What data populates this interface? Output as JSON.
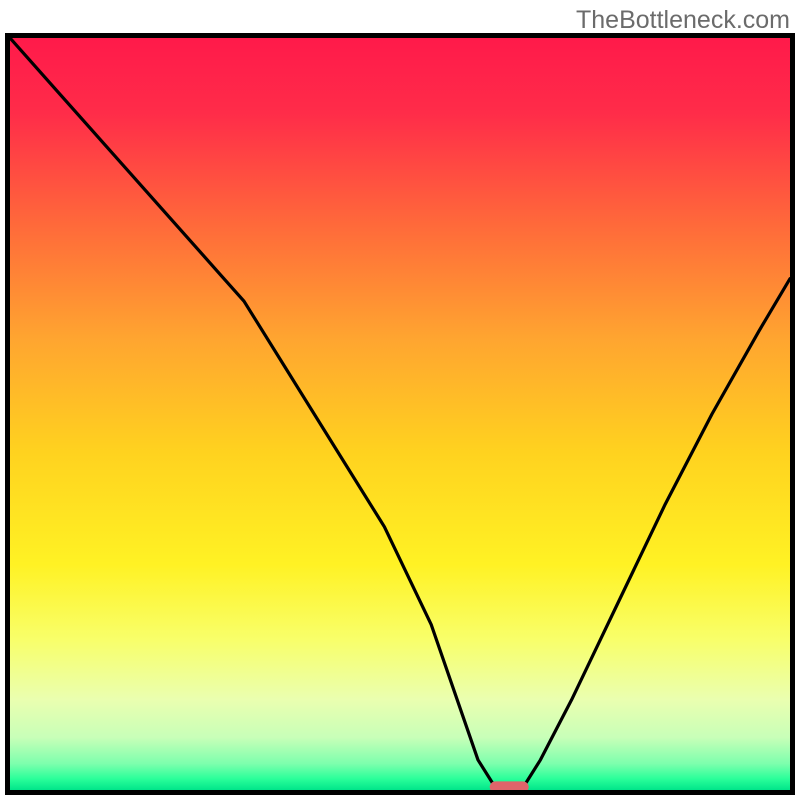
{
  "watermark": "TheBottleneck.com",
  "chart_data": {
    "type": "line",
    "title": "",
    "xlabel": "",
    "ylabel": "",
    "xlim": [
      0,
      100
    ],
    "ylim": [
      0,
      100
    ],
    "grid": false,
    "legend": false,
    "background_gradient": {
      "stops": [
        {
          "pos": 0.0,
          "color": "#ff1a4a"
        },
        {
          "pos": 0.1,
          "color": "#ff2c49"
        },
        {
          "pos": 0.25,
          "color": "#ff6a3a"
        },
        {
          "pos": 0.4,
          "color": "#ffa530"
        },
        {
          "pos": 0.55,
          "color": "#ffd21f"
        },
        {
          "pos": 0.7,
          "color": "#fff224"
        },
        {
          "pos": 0.8,
          "color": "#f8ff6a"
        },
        {
          "pos": 0.88,
          "color": "#eaffb0"
        },
        {
          "pos": 0.93,
          "color": "#c8ffb8"
        },
        {
          "pos": 0.965,
          "color": "#7dffad"
        },
        {
          "pos": 0.985,
          "color": "#2bff9a"
        },
        {
          "pos": 1.0,
          "color": "#00e58a"
        }
      ]
    },
    "series": [
      {
        "name": "bottleneck-curve",
        "color": "#000000",
        "x": [
          0,
          6,
          12,
          18,
          24,
          27,
          30,
          36,
          42,
          48,
          54,
          58,
          60,
          62,
          64,
          66,
          68,
          72,
          78,
          84,
          90,
          96,
          100
        ],
        "y": [
          100,
          93,
          86,
          79,
          72,
          68.5,
          65,
          55,
          45,
          35,
          22,
          10,
          4,
          0.7,
          0,
          0.7,
          4,
          12,
          25,
          38,
          50,
          61,
          68
        ]
      }
    ],
    "marker": {
      "name": "optimal-pill",
      "x": 64,
      "y": 0,
      "width": 5,
      "height": 1.5,
      "color": "#e0646a"
    }
  }
}
